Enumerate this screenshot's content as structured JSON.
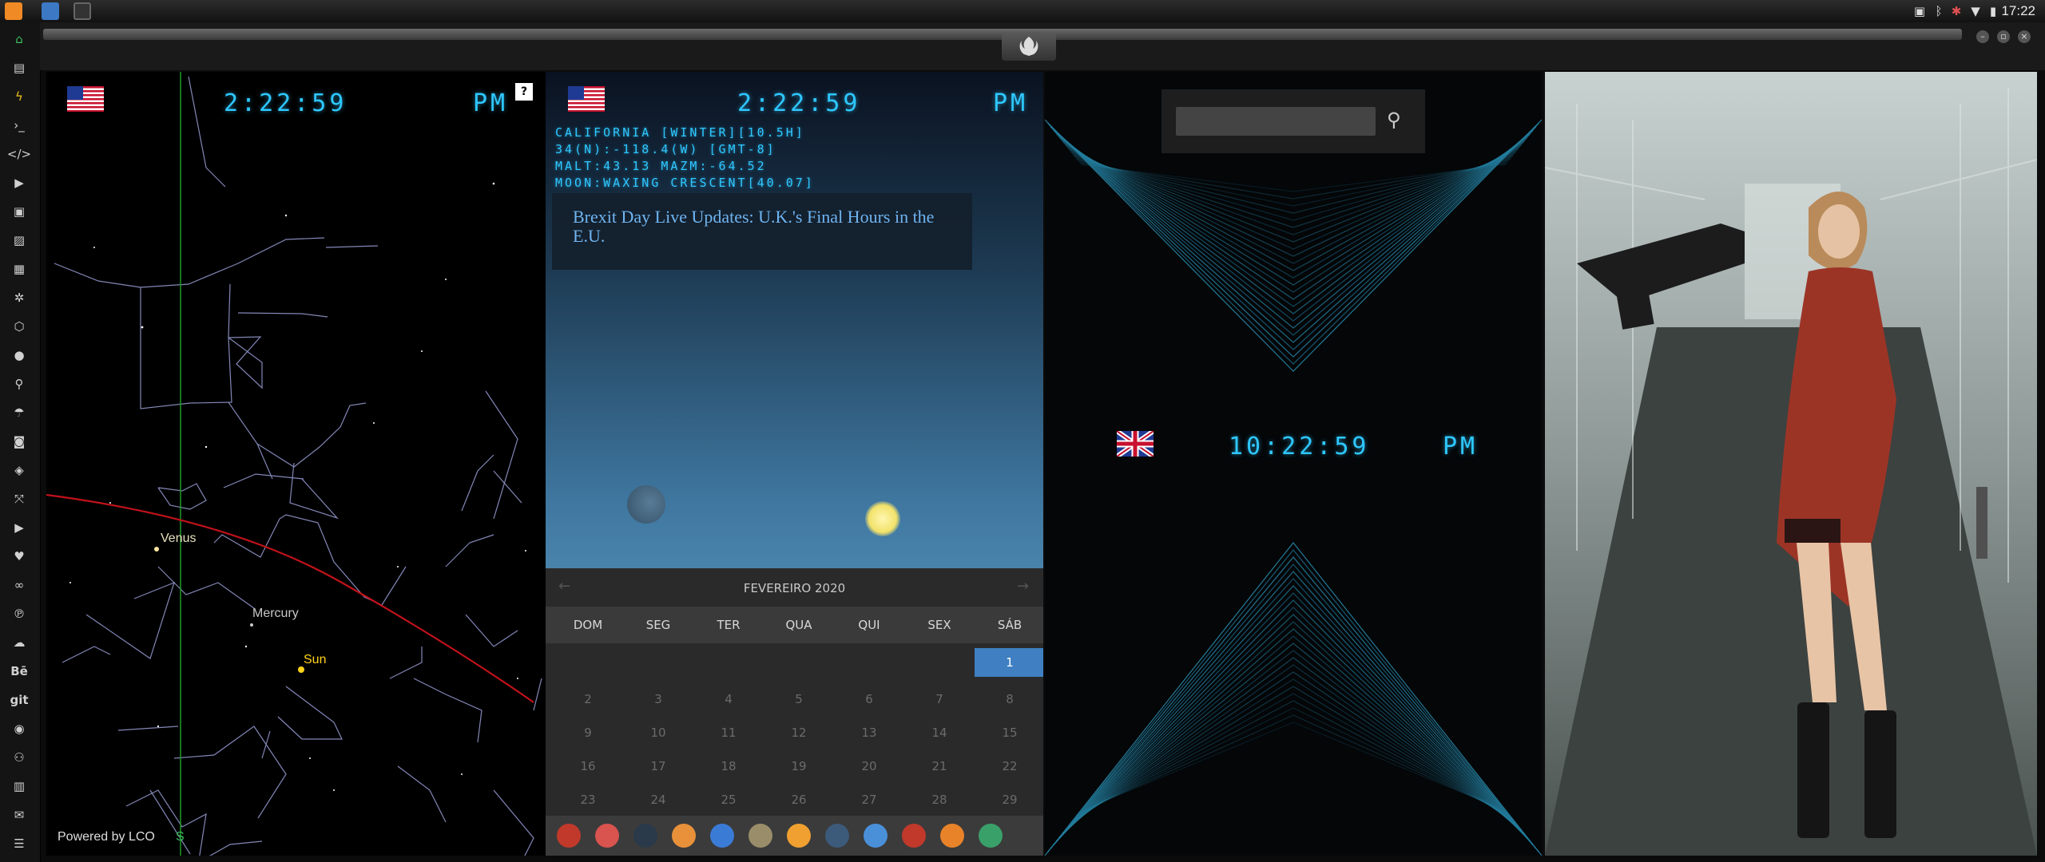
{
  "system_bar": {
    "clock": "17:22",
    "apps": [
      "sublime-icon",
      "files-icon",
      "terminal-icon"
    ],
    "tray": [
      "screenshot-icon",
      "bluetooth-icon",
      "bug-icon",
      "wifi-icon",
      "battery-icon"
    ]
  },
  "sidebar": {
    "icons": [
      "home-icon",
      "document-icon",
      "bolt-icon",
      "terminal-icon",
      "code-icon",
      "play-icon",
      "media-icon",
      "image-icon",
      "news-icon",
      "settings-icon",
      "hexagon-icon",
      "globe-icon",
      "search-icon",
      "umbrella-icon",
      "contact-icon",
      "git-icon",
      "expand-icon",
      "youtube-icon",
      "heart-icon",
      "link-icon",
      "pinterest-icon",
      "cloud-icon",
      "behance-icon",
      "git-text-icon",
      "github-icon",
      "people-icon",
      "map-icon",
      "mail-icon",
      "menu-icon"
    ],
    "behance_label": "Bē",
    "git_label": "git"
  },
  "panels": {
    "sky": {
      "time": "2:22:59",
      "ampm": "PM",
      "help": "?",
      "labels": {
        "venus": "Venus",
        "mercury": "Mercury",
        "sun": "Sun",
        "south": "S"
      },
      "credit": "Powered by LCO"
    },
    "weather": {
      "time": "2:22:59",
      "ampm": "PM",
      "info_lines": [
        "CALIFORNIA [WINTER][10.5H]",
        "34(N):-118.4(W) [GMT-8]",
        "MALT:43.13 MAZM:-64.52",
        "MOON:WAXING CRESCENT[40.07]"
      ],
      "headline": "Brexit Day Live Updates: U.K.'s Final Hours in the E.U.",
      "calendar": {
        "title": "FEVEREIRO 2020",
        "prev": "←",
        "next": "→",
        "weekdays": [
          "DOM",
          "SEG",
          "TER",
          "QUA",
          "QUI",
          "SEX",
          "SÁB"
        ],
        "weeks": [
          [
            "",
            "",
            "",
            "",
            "",
            "",
            "1"
          ],
          [
            "2",
            "3",
            "4",
            "5",
            "6",
            "7",
            "8"
          ],
          [
            "9",
            "10",
            "11",
            "12",
            "13",
            "14",
            "15"
          ],
          [
            "16",
            "17",
            "18",
            "19",
            "20",
            "21",
            "22"
          ],
          [
            "23",
            "24",
            "25",
            "26",
            "27",
            "28",
            "29"
          ]
        ],
        "selected": "1"
      },
      "dock": [
        "launcher-icon",
        "hourglass-icon",
        "planet-icon",
        "photos-icon",
        "translate-icon",
        "news-icon",
        "search-icon",
        "clock-icon",
        "globe-icon",
        "calendar-icon",
        "arrow-icon",
        "yandex-icon"
      ],
      "dock_colors": [
        "#c0392b",
        "#d9534f",
        "#2a3a4a",
        "#e8913a",
        "#3a7bd5",
        "#9a8d6a",
        "#f0a030",
        "#3c5a7a",
        "#4a90d9",
        "#c0392b",
        "#e8832a",
        "#3aa06a"
      ]
    },
    "geo": {
      "time": "10:22:59",
      "ampm": "PM"
    }
  },
  "colors": {
    "lcd": "#2ec7ff",
    "calendar_selected": "#3f7fc2",
    "ecliptic": "#c0121a"
  }
}
